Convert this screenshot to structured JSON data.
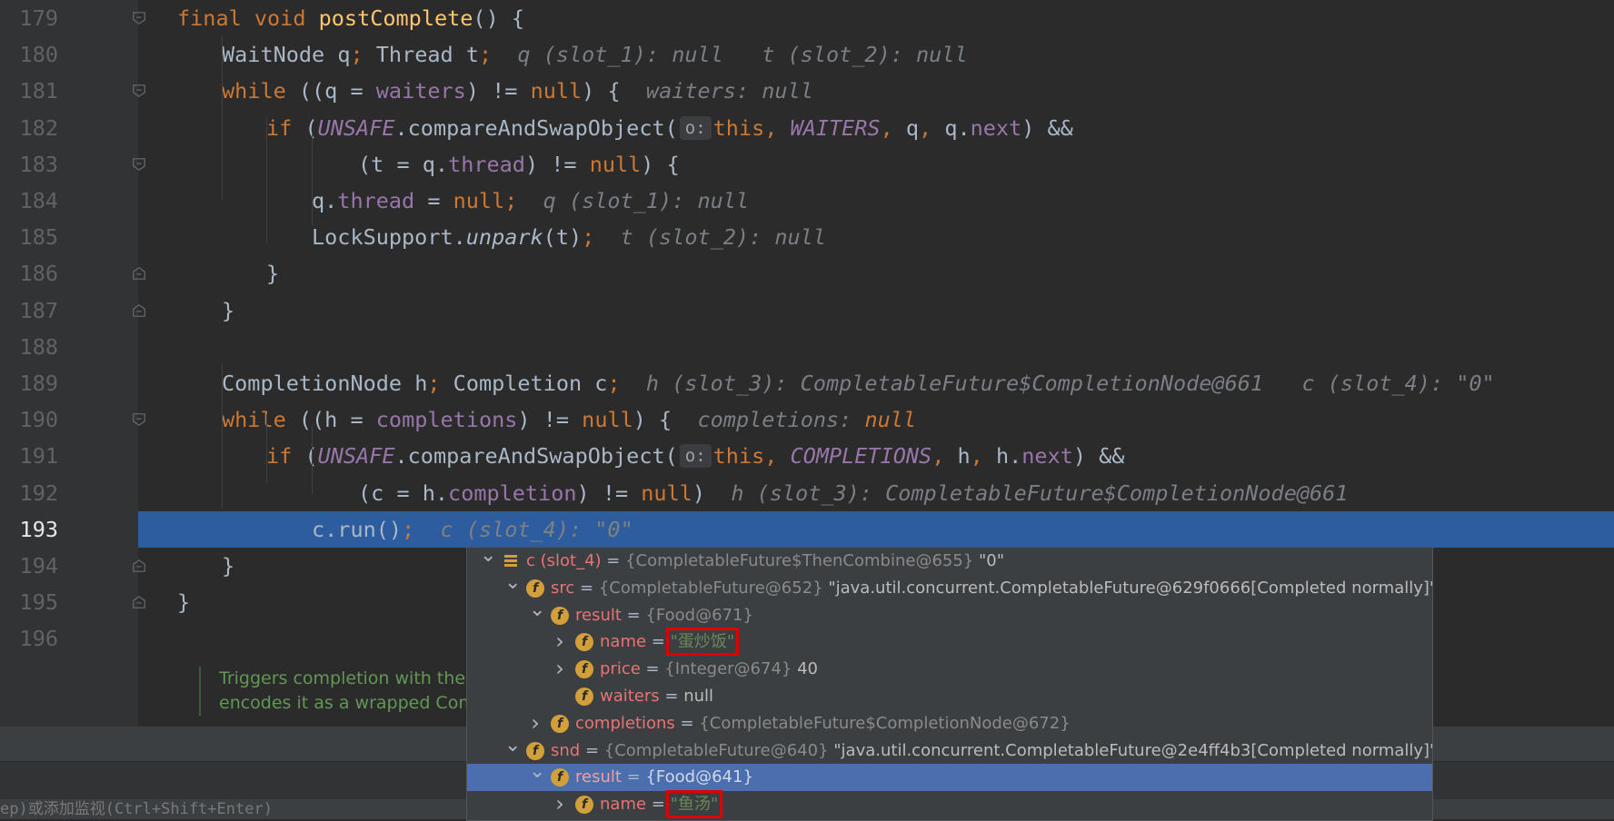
{
  "editor": {
    "lines": [
      {
        "num": "179",
        "code": [
          {
            "t": "final void ",
            "c": "kw"
          },
          {
            "t": "postComplete",
            "c": "fn"
          },
          {
            "t": "() {",
            "c": "tx"
          }
        ]
      },
      {
        "num": "180",
        "code": [
          {
            "t": "WaitNode q",
            "c": "tx"
          },
          {
            "t": "; ",
            "c": "kw"
          },
          {
            "t": "Thread t",
            "c": "tx"
          },
          {
            "t": ";",
            "c": "kw"
          },
          {
            "t": "  q (slot_1): null   t (slot_2): null",
            "c": "hint"
          }
        ]
      },
      {
        "num": "181",
        "code": [
          {
            "t": "while ",
            "c": "kw"
          },
          {
            "t": "((q = ",
            "c": "tx"
          },
          {
            "t": "waiters",
            "c": "fld"
          },
          {
            "t": ") != ",
            "c": "tx"
          },
          {
            "t": "null",
            "c": "kw"
          },
          {
            "t": ") {",
            "c": "tx"
          },
          {
            "t": "  waiters: null",
            "c": "hint"
          }
        ]
      },
      {
        "num": "182",
        "code": [
          {
            "t": "if ",
            "c": "kw"
          },
          {
            "t": "(",
            "c": "tx"
          },
          {
            "t": "UNSAFE",
            "c": "sfld"
          },
          {
            "t": ".compareAndSwapObject(",
            "c": "tx"
          },
          {
            "t": "o:",
            "c": "ph"
          },
          {
            "t": "this",
            "c": "kw"
          },
          {
            "t": ", ",
            "c": "kw"
          },
          {
            "t": "WAITERS",
            "c": "sfld"
          },
          {
            "t": ", ",
            "c": "kw"
          },
          {
            "t": "q",
            "c": "tx"
          },
          {
            "t": ", ",
            "c": "kw"
          },
          {
            "t": "q.",
            "c": "tx"
          },
          {
            "t": "next",
            "c": "fld"
          },
          {
            "t": ") &&",
            "c": "tx"
          }
        ]
      },
      {
        "num": "183",
        "code": [
          {
            "t": "(t = q.",
            "c": "tx"
          },
          {
            "t": "thread",
            "c": "fld"
          },
          {
            "t": ") != ",
            "c": "tx"
          },
          {
            "t": "null",
            "c": "kw"
          },
          {
            "t": ") {",
            "c": "tx"
          }
        ]
      },
      {
        "num": "184",
        "code": [
          {
            "t": "q.",
            "c": "tx"
          },
          {
            "t": "thread ",
            "c": "fld"
          },
          {
            "t": "= ",
            "c": "tx"
          },
          {
            "t": "null",
            "c": "kw"
          },
          {
            "t": ";",
            "c": "kw"
          },
          {
            "t": "  q (slot_1): null",
            "c": "hint"
          }
        ]
      },
      {
        "num": "185",
        "code": [
          {
            "t": "LockSupport.",
            "c": "tx"
          },
          {
            "t": "unpark",
            "c": "it tx"
          },
          {
            "t": "(t)",
            "c": "tx"
          },
          {
            "t": ";",
            "c": "kw"
          },
          {
            "t": "  t (slot_2): null",
            "c": "hint"
          }
        ]
      },
      {
        "num": "186",
        "code": [
          {
            "t": "}",
            "c": "tx"
          }
        ]
      },
      {
        "num": "187",
        "code": [
          {
            "t": "}",
            "c": "tx"
          }
        ]
      },
      {
        "num": "188",
        "code": []
      },
      {
        "num": "189",
        "code": [
          {
            "t": "CompletionNode h",
            "c": "tx"
          },
          {
            "t": "; ",
            "c": "kw"
          },
          {
            "t": "Completion c",
            "c": "tx"
          },
          {
            "t": ";",
            "c": "kw"
          },
          {
            "t": "  h (slot_3): CompletableFuture$CompletionNode@661   c (slot_4): \"0\"",
            "c": "hint"
          }
        ]
      },
      {
        "num": "190",
        "code": [
          {
            "t": "while ",
            "c": "kw"
          },
          {
            "t": "((h = ",
            "c": "tx"
          },
          {
            "t": "completions",
            "c": "fld"
          },
          {
            "t": ") != ",
            "c": "tx"
          },
          {
            "t": "null",
            "c": "kw"
          },
          {
            "t": ") {",
            "c": "tx"
          },
          {
            "t": "  completions: ",
            "c": "hint"
          },
          {
            "t": "null",
            "c": "hintn"
          }
        ]
      },
      {
        "num": "191",
        "code": [
          {
            "t": "if ",
            "c": "kw"
          },
          {
            "t": "(",
            "c": "tx"
          },
          {
            "t": "UNSAFE",
            "c": "sfld"
          },
          {
            "t": ".compareAndSwapObject(",
            "c": "tx"
          },
          {
            "t": "o:",
            "c": "ph"
          },
          {
            "t": "this",
            "c": "kw"
          },
          {
            "t": ", ",
            "c": "kw"
          },
          {
            "t": "COMPLETIONS",
            "c": "sfld"
          },
          {
            "t": ", ",
            "c": "kw"
          },
          {
            "t": "h",
            "c": "tx"
          },
          {
            "t": ", ",
            "c": "kw"
          },
          {
            "t": "h.",
            "c": "tx"
          },
          {
            "t": "next",
            "c": "fld"
          },
          {
            "t": ") &&",
            "c": "tx"
          }
        ]
      },
      {
        "num": "192",
        "code": [
          {
            "t": "(c = h.",
            "c": "tx"
          },
          {
            "t": "completion",
            "c": "fld"
          },
          {
            "t": ") != ",
            "c": "tx"
          },
          {
            "t": "null",
            "c": "kw"
          },
          {
            "t": ")",
            "c": "tx"
          },
          {
            "t": "  h (slot_3): CompletableFuture$CompletionNode@661",
            "c": "hint"
          }
        ]
      },
      {
        "num": "193",
        "code": [
          {
            "t": "c.run()",
            "c": "tx"
          },
          {
            "t": ";",
            "c": "kw"
          },
          {
            "t": "  c (slot_4): \"0\"",
            "c": "hint2"
          }
        ]
      },
      {
        "num": "194",
        "code": [
          {
            "t": "}",
            "c": "tx"
          }
        ]
      },
      {
        "num": "195",
        "code": [
          {
            "t": "}",
            "c": "tx"
          }
        ]
      },
      {
        "num": "196",
        "code": []
      }
    ],
    "doc_lines": [
      "Triggers completion with the",
      "encodes it as a wrapped Com"
    ]
  },
  "status_text": "ep)或添加监视(Ctrl+Shift+Enter)",
  "debugger_popup": {
    "rows": [
      {
        "name": "c (slot_4)",
        "type": "{CompletableFuture$ThenCombine@655}",
        "value": " \"0\"",
        "value_style": "val",
        "icon": "list-icon",
        "arrow": "expanded"
      },
      {
        "name": "src",
        "type": "{CompletableFuture@652}",
        "value": " \"java.util.concurrent.CompletableFuture@629f0666[Completed normally]\"",
        "value_style": "val",
        "icon": "field-icon",
        "arrow": "expanded"
      },
      {
        "name": "result",
        "type": "{Food@671}",
        "value": "",
        "value_style": "val",
        "icon": "field-icon",
        "arrow": "expanded"
      },
      {
        "name": "name",
        "type": "",
        "value": "\"蛋炒饭\"",
        "value_style": "str",
        "icon": "field-icon",
        "arrow": "collapsed",
        "boxed": true
      },
      {
        "name": "price",
        "type": "{Integer@674}",
        "value": " 40",
        "value_style": "val",
        "icon": "field-icon",
        "arrow": "collapsed"
      },
      {
        "name": "waiters",
        "type": "",
        "value": "null",
        "value_style": "val",
        "icon": "field-icon",
        "arrow": "none"
      },
      {
        "name": "completions",
        "type": "{CompletableFuture$CompletionNode@672}",
        "value": "",
        "value_style": "val",
        "icon": "field-icon",
        "arrow": "collapsed"
      },
      {
        "name": "snd",
        "type": "{CompletableFuture@640}",
        "value": " \"java.util.concurrent.CompletableFuture@2e4ff4b3[Completed normally]\"",
        "value_style": "val",
        "icon": "field-icon",
        "arrow": "expanded"
      },
      {
        "name": "result",
        "type": "{Food@641}",
        "value": "",
        "value_style": "val",
        "icon": "field-icon",
        "arrow": "expanded",
        "selected": true
      },
      {
        "name": "name",
        "type": "",
        "value": "\"鱼汤\"",
        "value_style": "str",
        "icon": "field-icon",
        "arrow": "collapsed",
        "boxed": true
      }
    ],
    "eq": " = ",
    "field_icon_letter": "f"
  }
}
